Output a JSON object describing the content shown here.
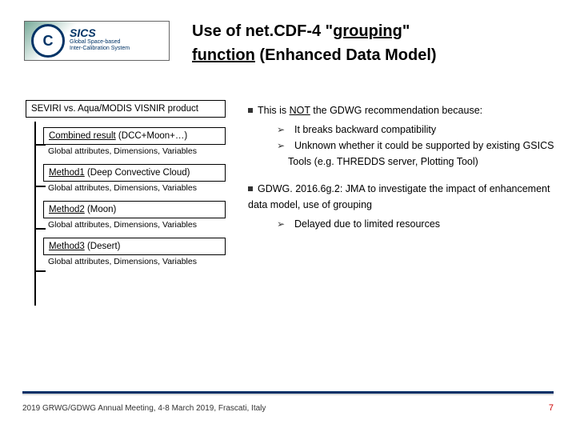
{
  "logo": {
    "big": "C",
    "name": "SICS",
    "sub1": "Global Space-based",
    "sub2": "Inter-Calibration System"
  },
  "title": {
    "l1a": "Use of net.CDF-4 \"",
    "l1b": "grouping",
    "l1c": "\"",
    "l2a": "function",
    "l2b": " (Enhanced Data Model)"
  },
  "tree": {
    "root": "SEVIRI vs. Aqua/MODIS VISNIR product",
    "n1a": "Combined result",
    "n1b": " (DCC+Moon+…)",
    "c1": "Global attributes, Dimensions, Variables",
    "n2a": "Method1",
    "n2b": " (Deep Convective Cloud)",
    "c2": "Global attributes, Dimensions, Variables",
    "n3a": "Method2",
    "n3b": " (Moon)",
    "c3": "Global attributes, Dimensions, Variables",
    "n4a": "Method3",
    "n4b": " (Desert)",
    "c4": "Global attributes, Dimensions, Variables"
  },
  "body": {
    "b1a": "This is ",
    "b1b": "NOT",
    "b1c": " the GDWG recommendation because:",
    "s1": "It breaks backward compatibility",
    "s2": "Unknown whether it could be supported by existing GSICS Tools (e.g. THREDDS server, Plotting Tool)",
    "b2": "GDWG. 2016.6g.2: JMA to investigate the impact of enhancement data model, use of grouping",
    "s3": "Delayed due to limited resources"
  },
  "footer": "2019 GRWG/GDWG Annual Meeting, 4-8 March 2019, Frascati, Italy",
  "page": "7"
}
